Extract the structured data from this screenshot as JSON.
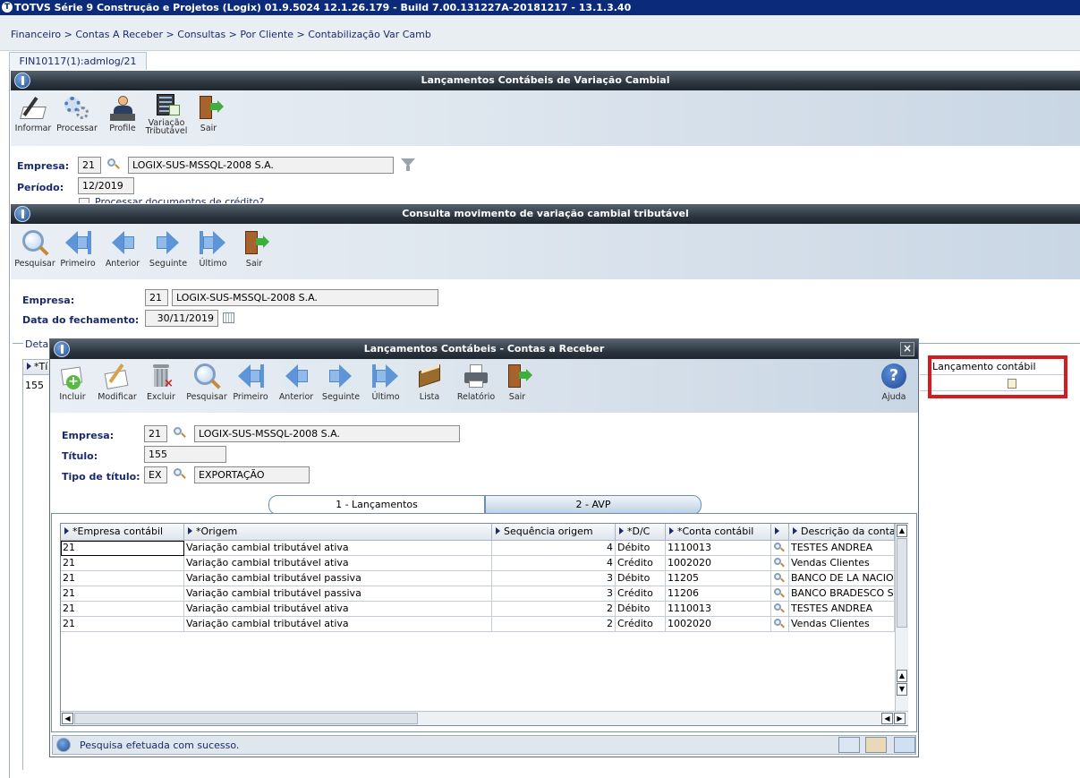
{
  "app": {
    "title": "TOTVS Série 9 Construção e Projetos (Logix) 01.9.5024   12.1.26.179 - Build 7.00.131227A-20181217 - 13.1.3.40",
    "breadcrumb": "Financeiro > Contas A Receber > Consultas > Por Cliente > Contabilização Var Camb",
    "program_tab": "FIN10117(1):admlog/21"
  },
  "win1": {
    "title": "Lançamentos Contábeis de Variação Cambial",
    "toolbar": {
      "informar": "Informar",
      "processar": "Processar",
      "profile": "Profile",
      "variacao_1": "Variação",
      "variacao_2": "Tributável",
      "sair": "Sair"
    },
    "empresa_label": "Empresa:",
    "empresa_code": "21",
    "empresa_name": "LOGIX-SUS-MSSQL-2008 S.A.",
    "periodo_label": "Período:",
    "periodo_value": "12/2019",
    "checkbox_label": "Processar documentos de crédito?"
  },
  "win2": {
    "title": "Consulta movimento de variação cambial tributável",
    "toolbar": {
      "pesquisar": "Pesquisar",
      "primeiro": "Primeiro",
      "anterior": "Anterior",
      "seguinte": "Seguinte",
      "ultimo": "Último",
      "sair": "Sair"
    },
    "empresa_label": "Empresa:",
    "empresa_code": "21",
    "empresa_name": "LOGIX-SUS-MSSQL-2008 S.A.",
    "data_label": "Data do fechamento:",
    "data_value": "30/11/2019",
    "detail_label": "Detalh",
    "bg_col_header": "*Tí",
    "bg_row_value": "155",
    "lanc_contabil_header": "Lançamento contábil"
  },
  "dialog": {
    "title": "Lançamentos Contábeis - Contas a Receber",
    "close": "×",
    "toolbar": {
      "incluir": "Incluir",
      "modificar": "Modificar",
      "excluir": "Excluir",
      "pesquisar": "Pesquisar",
      "primeiro": "Primeiro",
      "anterior": "Anterior",
      "seguinte": "Seguinte",
      "ultimo": "Último",
      "lista": "Lista",
      "relatorio": "Relatório",
      "sair": "Sair",
      "ajuda": "Ajuda"
    },
    "empresa_label": "Empresa:",
    "empresa_code": "21",
    "empresa_name": "LOGIX-SUS-MSSQL-2008 S.A.",
    "titulo_label": "Título:",
    "titulo_value": "155",
    "tipo_label": "Tipo de título:",
    "tipo_code": "EX",
    "tipo_name": "EXPORTAÇÃO",
    "tab1": "1 - Lançamentos",
    "tab2": "2 - AVP",
    "columns": [
      "*Empresa contábil",
      "*Origem",
      "Sequência origem",
      "*D/C",
      "*Conta contábil",
      "",
      "Descrição da conta c"
    ],
    "rows": [
      {
        "empresa": "21",
        "origem": "Variação cambial tributável ativa",
        "seq": "4",
        "dc": "Débito",
        "conta": "1110013",
        "desc": "TESTES ANDREA"
      },
      {
        "empresa": "21",
        "origem": "Variação cambial tributável ativa",
        "seq": "4",
        "dc": "Crédito",
        "conta": "1002020",
        "desc": "Vendas Clientes"
      },
      {
        "empresa": "21",
        "origem": "Variação cambial tributável passiva",
        "seq": "3",
        "dc": "Débito",
        "conta": "11205",
        "desc": "BANCO DE LA NACION A"
      },
      {
        "empresa": "21",
        "origem": "Variação cambial tributável passiva",
        "seq": "3",
        "dc": "Crédito",
        "conta": "11206",
        "desc": "BANCO BRADESCO SA"
      },
      {
        "empresa": "21",
        "origem": "Variação cambial tributável ativa",
        "seq": "2",
        "dc": "Débito",
        "conta": "1110013",
        "desc": "TESTES ANDREA"
      },
      {
        "empresa": "21",
        "origem": "Variação cambial tributável ativa",
        "seq": "2",
        "dc": "Crédito",
        "conta": "1002020",
        "desc": "Vendas Clientes"
      }
    ],
    "status": "Pesquisa efetuada com sucesso."
  },
  "colors": {
    "highlight": "#d71920",
    "title_bar": "#0b2a7a",
    "arrow": "#5d95d8"
  }
}
